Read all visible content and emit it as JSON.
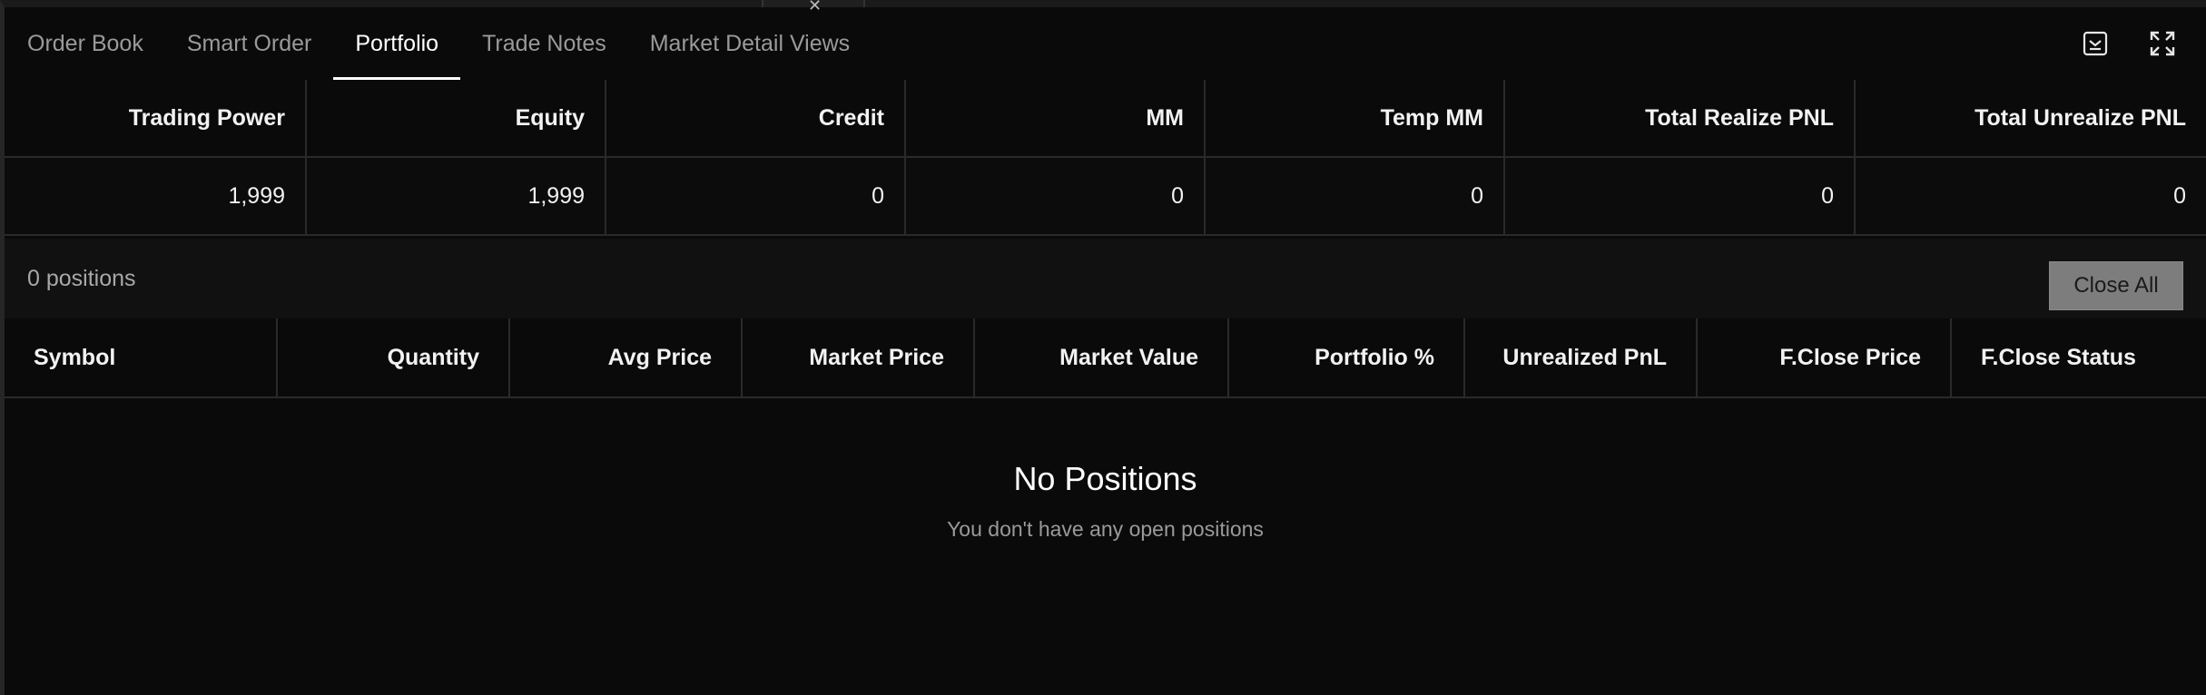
{
  "tabs": [
    {
      "label": "Order Book"
    },
    {
      "label": "Smart Order"
    },
    {
      "label": "Portfolio"
    },
    {
      "label": "Trade Notes"
    },
    {
      "label": "Market Detail Views"
    }
  ],
  "active_tab": "Portfolio",
  "tab_actions": {
    "minimize_icon": "collapse-down-icon",
    "expand_icon": "expand-icon"
  },
  "summary": {
    "headers": [
      "Trading Power",
      "Equity",
      "Credit",
      "MM",
      "Temp MM",
      "Total Realize PNL",
      "Total Unrealize PNL"
    ],
    "values": [
      "1,999",
      "1,999",
      "0",
      "0",
      "0",
      "0",
      "0"
    ]
  },
  "positions_bar": {
    "count_text": "0 positions",
    "close_all_label": "Close All"
  },
  "positions_table": {
    "headers": [
      "Symbol",
      "Quantity",
      "Avg Price",
      "Market Price",
      "Market Value",
      "Portfolio %",
      "Unrealized PnL",
      "F.Close Price",
      "F.Close Status"
    ]
  },
  "empty_state": {
    "title": "No Positions",
    "subtitle": "You don't have any open positions"
  }
}
